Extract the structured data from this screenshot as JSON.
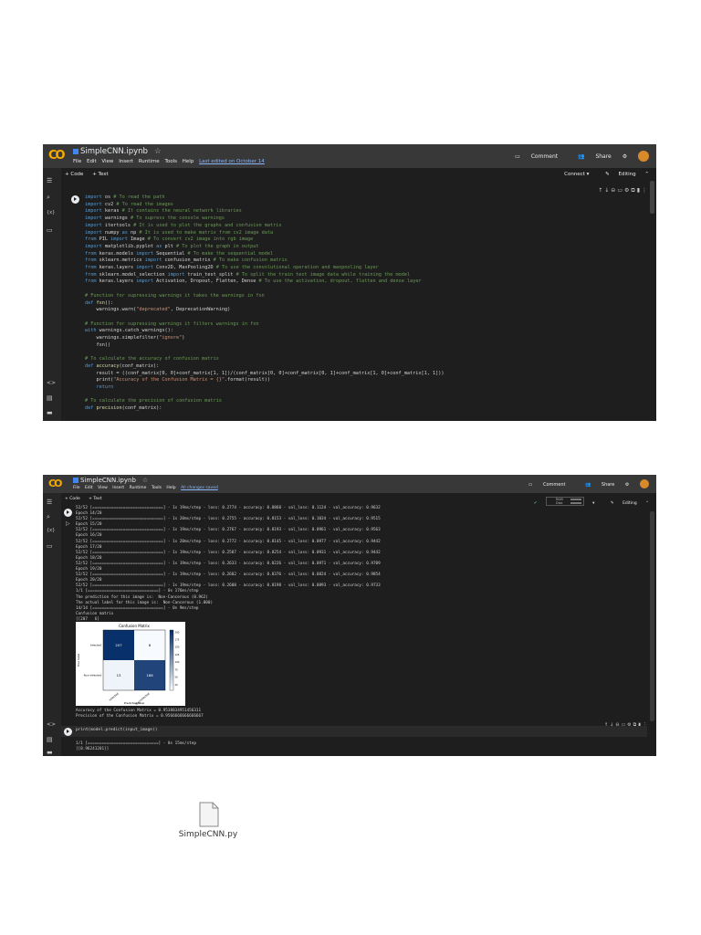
{
  "screenshot1": {
    "title": "SimpleCNN.ipynb",
    "menu": [
      "File",
      "Edit",
      "View",
      "Insert",
      "Runtime",
      "Tools",
      "Help"
    ],
    "last_edited": "Last edited on October 14",
    "actions": {
      "comment": "Comment",
      "share": "Share"
    },
    "toolbar": {
      "code": "+ Code",
      "text": "+ Text",
      "connect": "Connect ▾",
      "editing": "Editing"
    },
    "code_lines": [
      [
        [
          "kw",
          "import"
        ],
        [
          "",
          "os "
        ],
        [
          "cm",
          "# To read the path"
        ]
      ],
      [
        [
          "kw",
          "import"
        ],
        [
          "",
          "cv2 "
        ],
        [
          "cm",
          "# To read the images"
        ]
      ],
      [
        [
          "kw",
          "import"
        ],
        [
          "",
          "keras "
        ],
        [
          "cm",
          "# It contains the neural network libraries"
        ]
      ],
      [
        [
          "kw",
          "import"
        ],
        [
          "",
          "warnings "
        ],
        [
          "cm",
          "# To supress the console warnings"
        ]
      ],
      [
        [
          "kw",
          "import"
        ],
        [
          "",
          "itertools "
        ],
        [
          "cm",
          "# It is used to plot the graphs and confusion matrix"
        ]
      ],
      [
        [
          "kw",
          "import"
        ],
        [
          "",
          "numpy "
        ],
        [
          "kw",
          "as"
        ],
        [
          "",
          "np "
        ],
        [
          "cm",
          "# It is used to make matrix from cv2 image data"
        ]
      ],
      [
        [
          "kw",
          "from"
        ],
        [
          "",
          "PIL "
        ],
        [
          "kw",
          "import"
        ],
        [
          "",
          "Image "
        ],
        [
          "cm",
          "# To convert cv2 image into rgb image"
        ]
      ],
      [
        [
          "kw",
          "import"
        ],
        [
          "",
          "matplotlib.pyplot "
        ],
        [
          "kw",
          "as"
        ],
        [
          "",
          "plt "
        ],
        [
          "cm",
          "# To plot the graph in output"
        ]
      ],
      [
        [
          "kw",
          "from"
        ],
        [
          "",
          "keras.models "
        ],
        [
          "kw",
          "import"
        ],
        [
          "",
          "Sequential "
        ],
        [
          "cm",
          "# To make the sequential model"
        ]
      ],
      [
        [
          "kw",
          "from"
        ],
        [
          "",
          "sklearn.metrics "
        ],
        [
          "kw",
          "import"
        ],
        [
          "",
          "confusion_matrix "
        ],
        [
          "cm",
          "# To make confusion matrix"
        ]
      ],
      [
        [
          "kw",
          "from"
        ],
        [
          "",
          "keras.layers "
        ],
        [
          "kw",
          "import"
        ],
        [
          "",
          "Conv2D, MaxPooling2D "
        ],
        [
          "cm",
          "# To use the convolutional operation and maxpooling layer"
        ]
      ],
      [
        [
          "kw",
          "from"
        ],
        [
          "",
          "sklearn.model_selection "
        ],
        [
          "kw",
          "import"
        ],
        [
          "",
          "train_test_split "
        ],
        [
          "cm",
          "# To split the train test image data while training the model"
        ]
      ],
      [
        [
          "kw",
          "from"
        ],
        [
          "",
          "keras.layers "
        ],
        [
          "kw",
          "import"
        ],
        [
          "",
          "Activation, Dropout, Flatten, Dense "
        ],
        [
          "cm",
          "# To use the activation, dropout, flatten and dense layer"
        ]
      ],
      [
        [
          "",
          ""
        ]
      ],
      [
        [
          "cm",
          "# Function for supressing warnings it takes the warnings in fxn"
        ]
      ],
      [
        [
          "kw",
          "def"
        ],
        [
          "fn",
          "fxn"
        ],
        [
          "",
          "():"
        ]
      ],
      [
        [
          "",
          "    warnings.warn("
        ],
        [
          "st",
          "\"deprecated\""
        ],
        [
          "",
          ", DeprecationWarning)"
        ]
      ],
      [
        [
          "",
          ""
        ]
      ],
      [
        [
          "cm",
          "# Function for supressing warnings it filters warnings in fxn"
        ]
      ],
      [
        [
          "kw",
          "with"
        ],
        [
          "",
          "warnings.catch_warnings():"
        ]
      ],
      [
        [
          "",
          "    warnings.simplefilter("
        ],
        [
          "st",
          "\"ignore\""
        ],
        [
          "",
          ")"
        ]
      ],
      [
        [
          "",
          "    fxn()"
        ]
      ],
      [
        [
          "",
          ""
        ]
      ],
      [
        [
          "cm",
          "# To calculate the accuracy of confusion matrix"
        ]
      ],
      [
        [
          "kw",
          "def"
        ],
        [
          "fn",
          "accuracy"
        ],
        [
          "",
          "(conf_matrix):"
        ]
      ],
      [
        [
          "",
          "    result = ((conf_matrix[0, 0]+conf_matrix[1, 1])/(conf_matrix[0, 0]+conf_matrix[0, 1]+conf_matrix[1, 0]+conf_matrix[1, 1]))"
        ]
      ],
      [
        [
          "",
          "    print("
        ],
        [
          "st",
          "\"Accuracy of the Confusion Matrix = {}\""
        ],
        [
          "",
          ".format(result))"
        ]
      ],
      [
        [
          "kw",
          "    return"
        ]
      ],
      [
        [
          "",
          ""
        ]
      ],
      [
        [
          "cm",
          "# To calculate the precision of confusion matrix"
        ]
      ],
      [
        [
          "kw",
          "def"
        ],
        [
          "fn",
          "precision"
        ],
        [
          "",
          "(conf_matrix):"
        ]
      ]
    ]
  },
  "screenshot2": {
    "title": "SimpleCNN.ipynb",
    "menu": [
      "File",
      "Edit",
      "View",
      "Insert",
      "Runtime",
      "Tools",
      "Help"
    ],
    "last_edited": "All changes saved",
    "actions": {
      "comment": "Comment",
      "share": "Share"
    },
    "toolbar": {
      "code": "+ Code",
      "text": "+ Text",
      "editing": "Editing",
      "ram": "RAM",
      "disk": "Disk"
    },
    "training_output": [
      "52/52 [==============================] - 1s 19ms/step - loss: 0.2774 - accuracy: 0.8868 - val_loss: 0.1124 - val_accuracy: 0.9632",
      "Epoch 14/20",
      "52/52 [==============================] - 1s 20ms/step - loss: 0.2755 - accuracy: 0.8153 - val_loss: 0.1034 - val_accuracy: 0.9515",
      "Epoch 15/20",
      "52/52 [==============================] - 1s 19ms/step - loss: 0.2767 - accuracy: 0.8193 - val_loss: 0.0961 - val_accuracy: 0.9563",
      "Epoch 16/20",
      "52/52 [==============================] - 1s 20ms/step - loss: 0.2772 - accuracy: 0.8145 - val_loss: 0.0977 - val_accuracy: 0.9442",
      "Epoch 17/20",
      "52/52 [==============================] - 1s 19ms/step - loss: 0.2587 - accuracy: 0.8254 - val_loss: 0.0931 - val_accuracy: 0.9442",
      "Epoch 18/20",
      "52/52 [==============================] - 1s 19ms/step - loss: 0.2633 - accuracy: 0.8226 - val_loss: 0.0971 - val_accuracy: 0.9709",
      "Epoch 19/20",
      "52/52 [==============================] - 1s 19ms/step - loss: 0.2602 - accuracy: 0.8376 - val_loss: 0.0824 - val_accuracy: 0.9854",
      "Epoch 20/20",
      "52/52 [==============================] - 1s 19ms/step - loss: 0.2600 - accuracy: 0.8198 - val_loss: 0.0893 - val_accuracy: 0.9733",
      "1/1 [==============================] - 0s 176ms/step",
      "The prediction for this image is:  Non-Cancerous (0.962)",
      "The actual label for this image is:  Non-Cancerous (1.000)",
      "14/14 [==============================] - 0s 9ms/step",
      "Confusion matrix",
      "[[207   6]",
      " [ 13 186]]"
    ],
    "accuracy_output": [
      "Accuracy of the Confusion Matrix = 0.9538834951456311",
      "Precision of the Confusion Matrix = 0.9566666666666667"
    ],
    "cell2_code": "print(model.predict(input_image))",
    "cell2_output": [
      "1/1 [==============================] - 0s 15ms/step",
      "[[0.96241201]]"
    ]
  },
  "chart_data": {
    "type": "heatmap",
    "title": "Confusion Matrix",
    "xlabel": "Predicted label",
    "ylabel": "True label",
    "x_categories": [
      "Infected",
      "Non-Infected"
    ],
    "y_categories": [
      "Infected",
      "Non-Infected"
    ],
    "values": [
      [
        207,
        6
      ],
      [
        13,
        186
      ]
    ],
    "colorbar_ticks": [
      25,
      50,
      75,
      100,
      125,
      150,
      175,
      200
    ],
    "colormap": {
      "low": "#f7fbff",
      "high": "#08306b"
    }
  },
  "file": {
    "name": "SimpleCNN.py"
  }
}
